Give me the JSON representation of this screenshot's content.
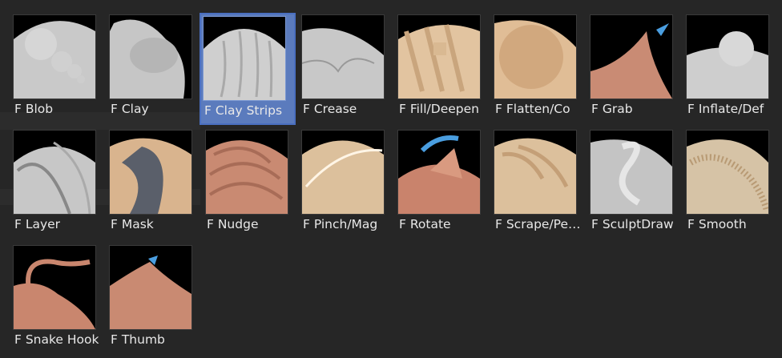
{
  "brushes": [
    {
      "label": "F Blob",
      "icon": "blob-brush-icon",
      "selected": false
    },
    {
      "label": "F Clay",
      "icon": "clay-brush-icon",
      "selected": false
    },
    {
      "label": "F Clay Strips",
      "icon": "clay-strips-brush-icon",
      "selected": true
    },
    {
      "label": "F Crease",
      "icon": "crease-brush-icon",
      "selected": false
    },
    {
      "label": "F Fill/Deepen",
      "icon": "fill-deepen-brush-icon",
      "selected": false
    },
    {
      "label": "F Flatten/Co",
      "icon": "flatten-contrast-brush-icon",
      "selected": false
    },
    {
      "label": "F Grab",
      "icon": "grab-brush-icon",
      "selected": false
    },
    {
      "label": "F Inflate/Def",
      "icon": "inflate-deflate-brush-icon",
      "selected": false
    },
    {
      "label": "F Layer",
      "icon": "layer-brush-icon",
      "selected": false
    },
    {
      "label": "F Mask",
      "icon": "mask-brush-icon",
      "selected": false
    },
    {
      "label": "F Nudge",
      "icon": "nudge-brush-icon",
      "selected": false
    },
    {
      "label": "F Pinch/Mag",
      "icon": "pinch-magnify-brush-icon",
      "selected": false
    },
    {
      "label": "F Rotate",
      "icon": "rotate-brush-icon",
      "selected": false
    },
    {
      "label": "F Scrape/Pe…",
      "icon": "scrape-peaks-brush-icon",
      "selected": false
    },
    {
      "label": "F SculptDraw",
      "icon": "sculpt-draw-brush-icon",
      "selected": false
    },
    {
      "label": "F Smooth",
      "icon": "smooth-brush-icon",
      "selected": false
    },
    {
      "label": "F Snake Hook",
      "icon": "snake-hook-brush-icon",
      "selected": false
    },
    {
      "label": "F Thumb",
      "icon": "thumb-brush-icon",
      "selected": false
    }
  ],
  "colors": {
    "background": "#262626",
    "selected": "#5b7bbd",
    "label": "#e8e8e8",
    "accent_arrow": "#4a9ee0"
  }
}
